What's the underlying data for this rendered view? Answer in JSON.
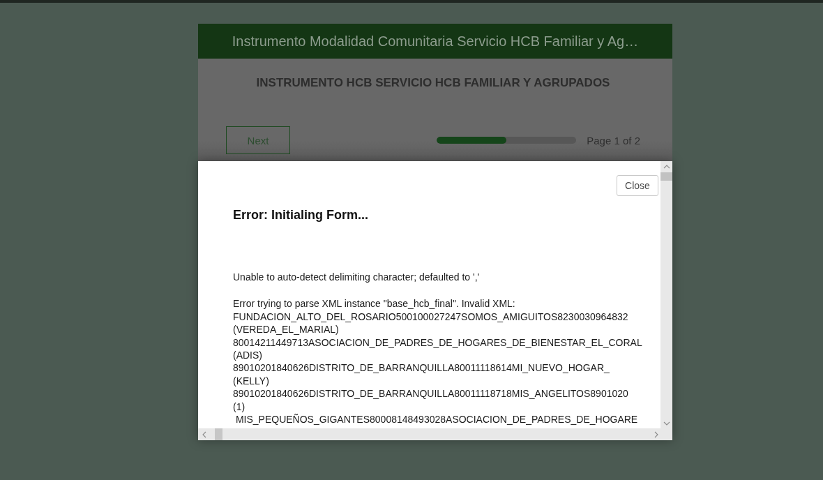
{
  "form": {
    "header_title": "Instrumento Modalidad Comunitaria Servicio HCB Familiar y Ag…",
    "title": "INSTRUMENTO HCB SERVICIO HCB FAMILIAR Y AGRUPADOS",
    "next_button": "Next",
    "progress": {
      "level": 0.5
    },
    "page_indicator": "Page 1 of 2"
  },
  "dialog": {
    "close_button": "Close",
    "title": "Error: Initialing Form...",
    "paragraphs": [
      {
        "lines": [
          "Unable to auto-detect delimiting character; defaulted to ','"
        ]
      },
      {
        "lines": [
          "Error trying to parse XML instance \"base_hcb_final\". Invalid XML:",
          "FUNDACION_ALTO_DEL_ROSARIO500100027247SOMOS_AMIGUITOS8230030964832",
          "(VEREDA_EL_MARIAL)",
          "80014211449713ASOCIACION_DE_PADRES_DE_HOGARES_DE_BIENESTAR_EL_CORAL",
          "(ADIS)",
          "89010201840626DISTRITO_DE_BARRANQUILLA80011118614MI_NUEVO_HOGAR_",
          "(KELLY)",
          "89010201840626DISTRITO_DE_BARRANQUILLA80011118718MIS_ANGELITOS8901020",
          "(1)",
          " MIS_PEQUEÑOS_GIGANTES80008148493028ASOCIACION_DE_PADRES_DE_HOGARE"
        ]
      }
    ]
  }
}
